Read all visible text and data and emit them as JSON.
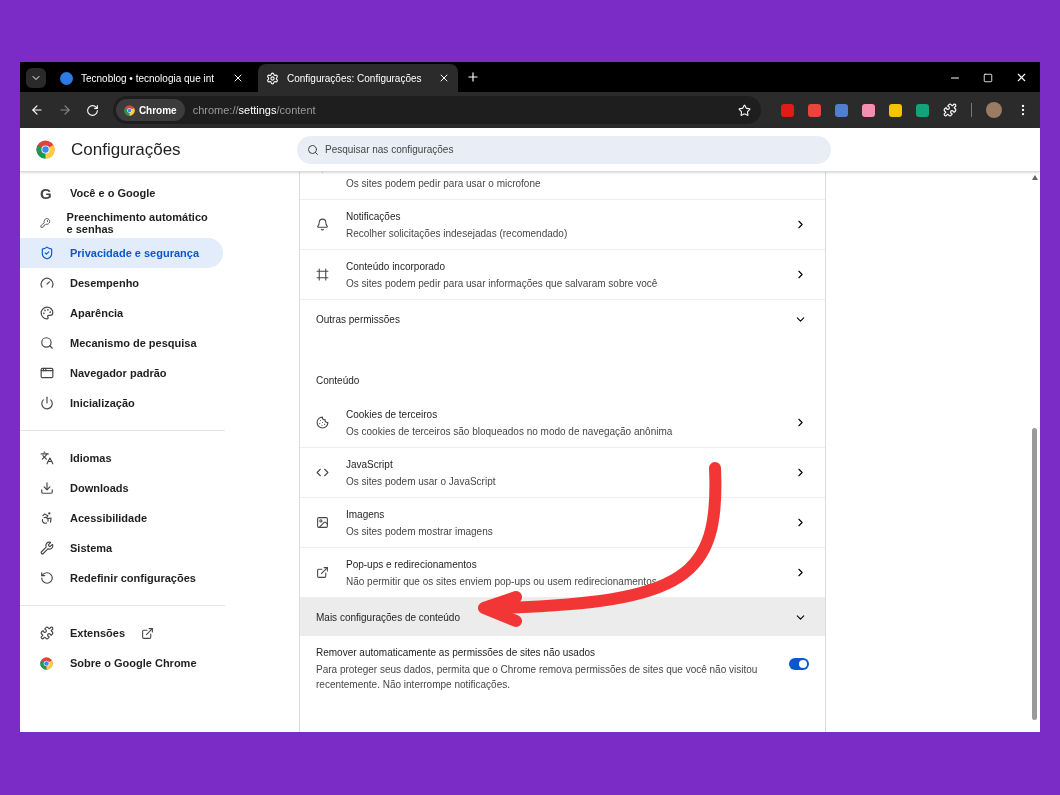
{
  "tabs": [
    {
      "title": "Tecnoblog • tecnologia que int",
      "selected": false
    },
    {
      "title": "Configurações: Configurações",
      "selected": true
    }
  ],
  "toolbar": {
    "chip": "Chrome",
    "url_scheme": "chrome://",
    "url_host": "settings",
    "url_path": "/content"
  },
  "header": {
    "title": "Configurações",
    "search": {
      "placeholder": "Pesquisar nas configurações"
    }
  },
  "sidebar": {
    "google_glyph": "G",
    "groups": [
      [
        {
          "label": "Você e o Google",
          "selected": false,
          "kind": "link"
        },
        {
          "label": "Preenchimento automático e senhas",
          "selected": false,
          "kind": "link"
        },
        {
          "label": "Privacidade e segurança",
          "selected": true,
          "kind": "link"
        },
        {
          "label": "Desempenho",
          "selected": false,
          "kind": "link"
        },
        {
          "label": "Aparência",
          "selected": false,
          "kind": "link"
        },
        {
          "label": "Mecanismo de pesquisa",
          "selected": false,
          "kind": "link"
        },
        {
          "label": "Navegador padrão",
          "selected": false,
          "kind": "link"
        },
        {
          "label": "Inicialização",
          "selected": false,
          "kind": "link"
        }
      ],
      [
        {
          "label": "Idiomas",
          "selected": false,
          "kind": "link"
        },
        {
          "label": "Downloads",
          "selected": false,
          "kind": "link"
        },
        {
          "label": "Acessibilidade",
          "selected": false,
          "kind": "link"
        },
        {
          "label": "Sistema",
          "selected": false,
          "kind": "link"
        },
        {
          "label": "Redefinir configurações",
          "selected": false,
          "kind": "link"
        }
      ],
      [
        {
          "label": "Extensões",
          "selected": false,
          "kind": "external"
        },
        {
          "label": "Sobre o Google Chrome",
          "selected": false,
          "kind": "link"
        }
      ]
    ]
  },
  "content": {
    "rows": [
      {
        "kind": "partial",
        "description": "Os sites podem pedir para usar o microfone"
      },
      {
        "kind": "setting",
        "title": "Notificações",
        "description": "Recolher solicitações indesejadas (recomendado)"
      },
      {
        "kind": "setting",
        "title": "Conteúdo incorporado",
        "description": "Os sites podem pedir para usar informações que salvaram sobre você"
      },
      {
        "kind": "expander",
        "title": "Outras permissões",
        "expanded": false,
        "highlighted": false
      },
      {
        "kind": "heading",
        "title": "Conteúdo"
      },
      {
        "kind": "setting",
        "title": "Cookies de terceiros",
        "description": "Os cookies de terceiros são bloqueados no modo de navegação anônima"
      },
      {
        "kind": "setting",
        "title": "JavaScript",
        "description": "Os sites podem usar o JavaScript"
      },
      {
        "kind": "setting",
        "title": "Imagens",
        "description": "Os sites podem mostrar imagens"
      },
      {
        "kind": "setting",
        "title": "Pop-ups e redirecionamentos",
        "description": "Não permitir que os sites enviem pop-ups ou usem redirecionamentos"
      },
      {
        "kind": "expander",
        "title": "Mais configurações de conteúdo",
        "expanded": false,
        "highlighted": true
      },
      {
        "kind": "toggle",
        "title": "Remover automaticamente as permissões de sites não usados",
        "description": "Para proteger seus dados, permita que o Chrome remova permissões de sites que você não visitou recentemente. Não interrompe notificações.",
        "on": true
      }
    ]
  }
}
